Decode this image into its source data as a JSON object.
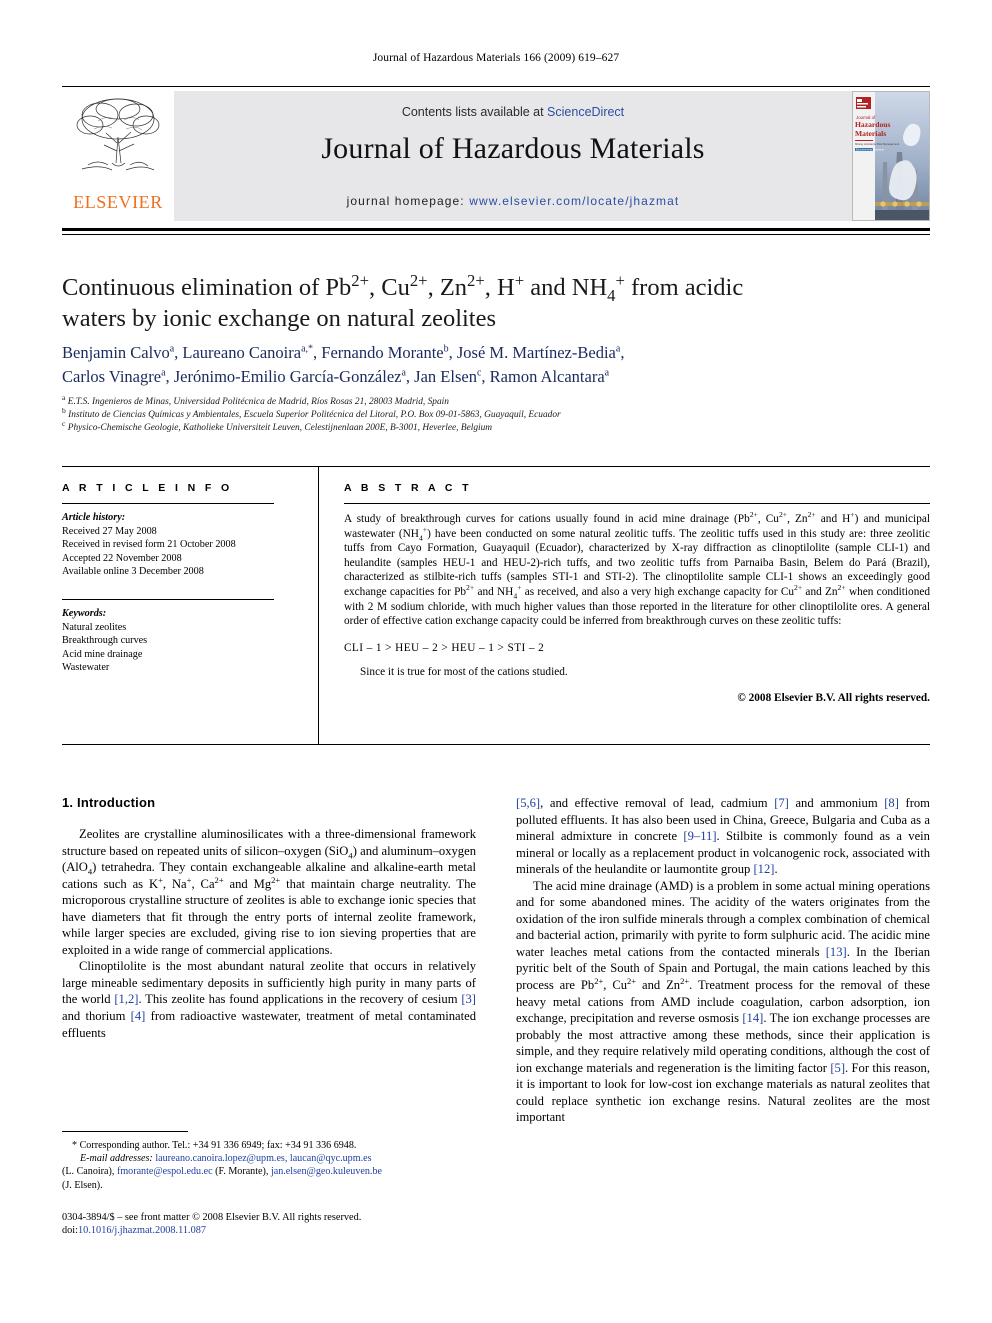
{
  "running_head": "Journal of Hazardous Materials 166 (2009) 619–627",
  "masthead": {
    "contents_prefix": "Contents lists available at ",
    "sciencedirect": "ScienceDirect",
    "journal_name": "Journal of Hazardous Materials",
    "homepage_prefix": "journal homepage:",
    "homepage_url": "www.elsevier.com/locate/jhazmat",
    "publisher": "ELSEVIER",
    "cover_title_line1": "Hazardous",
    "cover_title_line2": "Materials",
    "cover_kicker": "Journal of",
    "brand_orange": "#f06f1e",
    "link_blue": "#2b4fa2"
  },
  "article": {
    "title_line1": "Continuous elimination of Pb2+, Cu2+, Zn2+, H+ and NH4+ from acidic",
    "title_line2": "waters by ionic exchange on natural zeolites",
    "authors_line1": "Benjamin Calvo a, Laureano Canoira a,*, Fernando Morante b, José M. Martínez-Bedia a,",
    "authors_line2": "Carlos Vinagre a, Jerónimo-Emilio García-González a, Jan Elsen c, Ramon Alcantara a",
    "affiliations": [
      "E.T.S. Ingenieros de Minas, Universidad Politécnica de Madrid, Ríos Rosas 21, 28003 Madrid, Spain",
      "Instituto de Ciencias Químicas y Ambientales, Escuela Superior Politécnica del Litoral, P.O. Box 09-01-5863, Guayaquil, Ecuador",
      "Physico-Chemische Geologie, Katholieke Universiteit Leuven, Celestijnenlaan 200E, B-3001, Heverlee, Belgium"
    ],
    "affiliation_marks": [
      "a",
      "b",
      "c"
    ]
  },
  "info": {
    "heading": "A R T I C L E    I N F O",
    "history_label": "Article history:",
    "history": [
      "Received 27 May 2008",
      "Received in revised form 21 October 2008",
      "Accepted 22 November 2008",
      "Available online 3 December 2008"
    ],
    "keywords_label": "Keywords:",
    "keywords": [
      "Natural zeolites",
      "Breakthrough curves",
      "Acid mine drainage",
      "Wastewater"
    ]
  },
  "abstract": {
    "heading": "A B S T R A C T",
    "body": "A study of breakthrough curves for cations usually found in acid mine drainage (Pb2+, Cu2+, Zn2+ and H+) and municipal wastewater (NH4+) have been conducted on some natural zeolitic tuffs. The zeolitic tuffs used in this study are: three zeolitic tuffs from Cayo Formation, Guayaquil (Ecuador), characterized by X-ray diffraction as clinoptilolite (sample CLI-1) and heulandite (samples HEU-1 and HEU-2)-rich tuffs, and two zeolitic tuffs from Parnaiba Basin, Belem do Pará (Brazil), characterized as stilbite-rich tuffs (samples STI-1 and STI-2). The clinoptilolite sample CLI-1 shows an exceedingly good exchange capacities for Pb2+ and NH4+ as received, and also a very high exchange capacity for Cu2+ and Zn2+ when conditioned with 2 M sodium chloride, with much higher values than those reported in the literature for other clinoptilolite ores. A general order of effective cation exchange capacity could be inferred from breakthrough curves on these zeolitic tuffs:",
    "order": "CLI – 1  >  HEU – 2  >  HEU – 1  >  STI – 2",
    "since": "Since it is true for most of the cations studied.",
    "copyright": "© 2008 Elsevier B.V. All rights reserved."
  },
  "introduction": {
    "heading": "1.  Introduction",
    "left_paragraphs": [
      "Zeolites are crystalline aluminosilicates with a three-dimensional framework structure based on repeated units of silicon–oxygen (SiO4) and aluminum–oxygen (AlO4) tetrahedra. They contain exchangeable alkaline and alkaline-earth metal cations such as K+, Na+, Ca2+ and Mg2+ that maintain charge neutrality. The microporous crystalline structure of zeolites is able to exchange ionic species that have diameters that fit through the entry ports of internal zeolite framework, while larger species are excluded, giving rise to ion sieving properties that are exploited in a wide range of commercial applications.",
      "Clinoptilolite is the most abundant natural zeolite that occurs in relatively large mineable sedimentary deposits in sufficiently high purity in many parts of the world [1,2]. This zeolite has found applications in the recovery of cesium [3] and thorium [4] from radioactive wastewater, treatment of metal contaminated effluents"
    ],
    "right_paragraphs": [
      "[5,6], and effective removal of lead, cadmium [7] and ammonium [8] from polluted effluents. It has also been used in China, Greece, Bulgaria and Cuba as a mineral admixture in concrete [9–11]. Stilbite is commonly found as a vein mineral or locally as a replacement product in volcanogenic rock, associated with minerals of the heulandite or laumontite group [12].",
      "The acid mine drainage (AMD) is a problem in some actual mining operations and for some abandoned mines. The acidity of the waters originates from the oxidation of the iron sulfide minerals through a complex combination of chemical and bacterial action, primarily with pyrite to form sulphuric acid. The acidic mine water leaches metal cations from the contacted minerals [13]. In the Iberian pyritic belt of the South of Spain and Portugal, the main cations leached by this process are Pb2+, Cu2+ and Zn2+. Treatment process for the removal of these heavy metal cations from AMD include coagulation, carbon adsorption, ion exchange, precipitation and reverse osmosis [14]. The ion exchange processes are probably the most attractive among these methods, since their application is simple, and they require relatively mild operating conditions, although the cost of ion exchange materials and regeneration is the limiting factor [5]. For this reason, it is important to look for low-cost ion exchange materials as natural zeolites that could replace synthetic ion exchange resins. Natural zeolites are the most important"
    ]
  },
  "footnote": {
    "corresponding": "* Corresponding author. Tel.: +34 91 336 6949; fax: +34 91 336 6948.",
    "email_label": "E-mail addresses:",
    "emails": "laureano.canoira.lopez@upm.es, laucan@qyc.upm.es",
    "email_names_1": "(L. Canoira),",
    "email_2": "fmorante@espol.edu.ec",
    "email_names_2": "(F. Morante),",
    "email_3": "jan.elsen@geo.kuleuven.be",
    "email_names_3": "(J. Elsen)."
  },
  "imprint": {
    "issn_line": "0304-3894/$ – see front matter © 2008 Elsevier B.V. All rights reserved.",
    "doi_label": "doi:",
    "doi_value": "10.1016/j.jhazmat.2008.11.087"
  }
}
